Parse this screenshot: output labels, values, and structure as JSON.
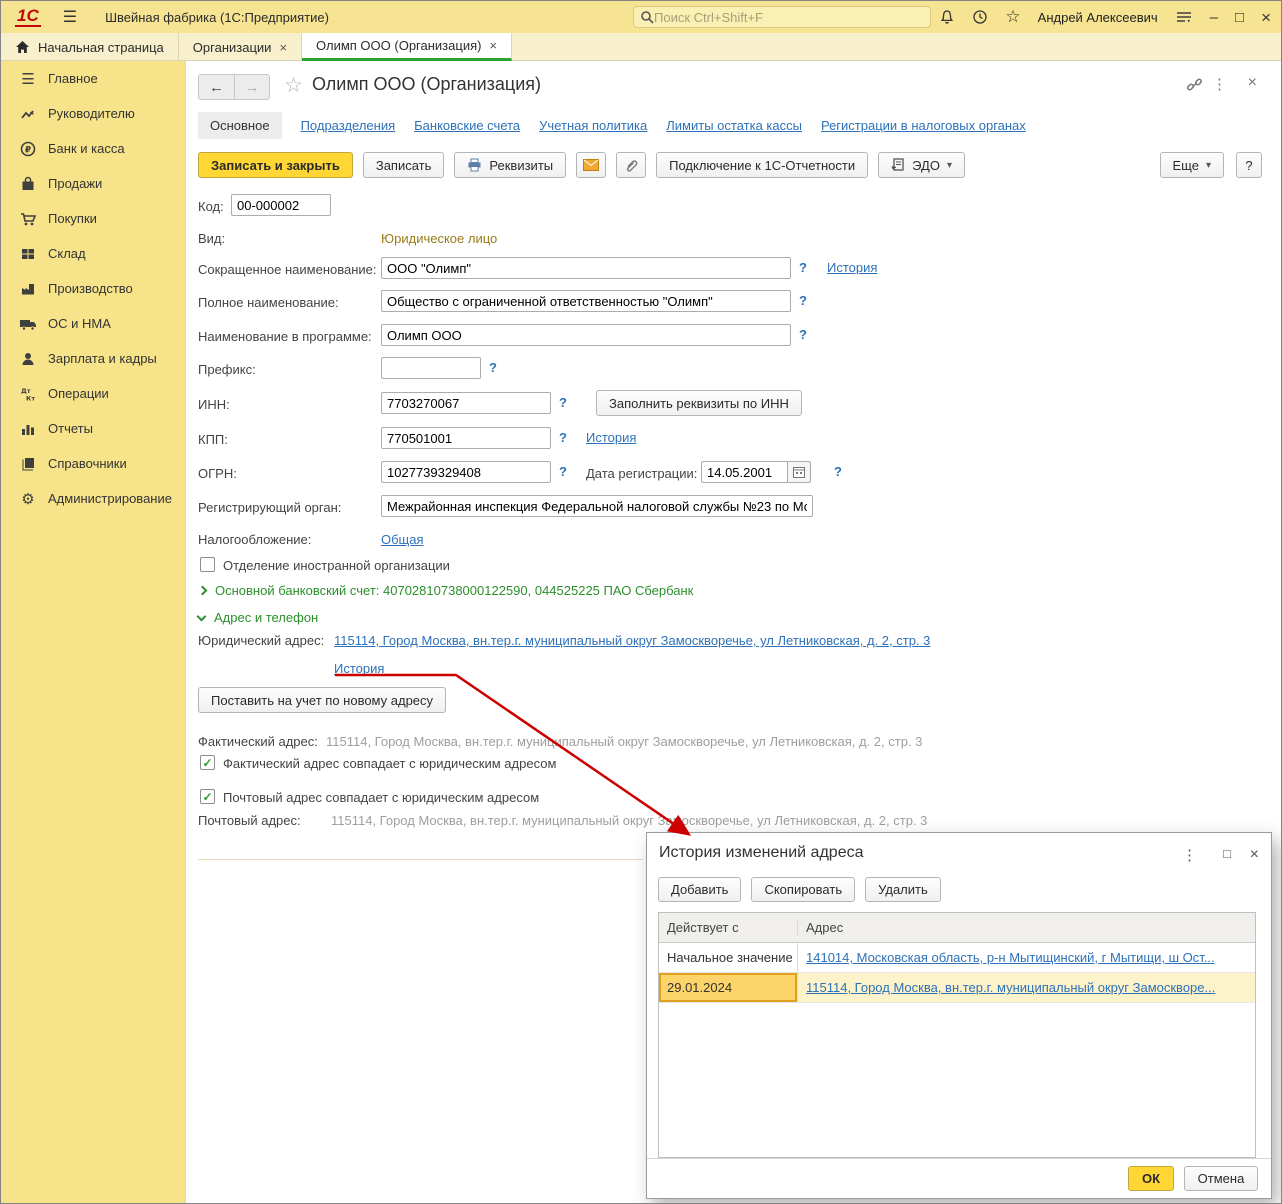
{
  "icons": {
    "hamburger": "☰",
    "star": "☆",
    "minimize": "–",
    "maximize": "□",
    "close": "×",
    "back": "←",
    "forward": "→",
    "menu_dots": "⋮",
    "dropdown": "▾",
    "check": "✓",
    "help_mark": "?",
    "gear": "⚙"
  },
  "colors": {
    "titlebar_bg": "#f6e492",
    "sidebar_bg": "#f6e38a",
    "tabbar_bg": "#f8f0cd",
    "accent_yellow": "#ffd633",
    "selection_border": "#dfa21c",
    "link_blue": "#2e71b8",
    "section_green": "#2c8f2c",
    "active_tab_green": "#2da12e",
    "annotation_red": "#cc0000"
  },
  "titlebar": {
    "logo": "1С",
    "app_title": "Швейная фабрика  (1С:Предприятие)",
    "search_placeholder": "Поиск Ctrl+Shift+F",
    "user_name": "Андрей Алексеевич"
  },
  "window_tabs": [
    {
      "label": "Начальная страница",
      "icon": "home-icon"
    },
    {
      "label": "Организации",
      "closable": true
    },
    {
      "label": "Олимп ООО (Организация)",
      "closable": true,
      "active": true
    }
  ],
  "sidebar": {
    "items": [
      {
        "label": "Главное",
        "icon": "menu-lines-icon"
      },
      {
        "label": "Руководителю",
        "icon": "trend-icon"
      },
      {
        "label": "Банк и касса",
        "icon": "ruble-icon"
      },
      {
        "label": "Продажи",
        "icon": "bag-icon"
      },
      {
        "label": "Покупки",
        "icon": "cart-icon"
      },
      {
        "label": "Склад",
        "icon": "warehouse-icon"
      },
      {
        "label": "Производство",
        "icon": "factory-icon"
      },
      {
        "label": "ОС и НМА",
        "icon": "truck-icon"
      },
      {
        "label": "Зарплата и кадры",
        "icon": "person-icon"
      },
      {
        "label": "Операции",
        "icon": "dtkt-icon"
      },
      {
        "label": "Отчеты",
        "icon": "chart-icon"
      },
      {
        "label": "Справочники",
        "icon": "books-icon"
      },
      {
        "label": "Администрирование",
        "icon": "gear-icon"
      }
    ]
  },
  "form": {
    "title": "Олимп ООО (Организация)",
    "nav_tabs": [
      {
        "label": "Основное",
        "active": true
      },
      {
        "label": "Подразделения"
      },
      {
        "label": "Банковские счета"
      },
      {
        "label": "Учетная политика"
      },
      {
        "label": "Лимиты остатка кассы"
      },
      {
        "label": "Регистрации в налоговых органах"
      }
    ],
    "toolbar": {
      "save_close": "Записать и закрыть",
      "save": "Записать",
      "requisites": "Реквизиты",
      "connect": "Подключение к 1С-Отчетности",
      "edo": "ЭДО",
      "more": "Еще",
      "help": "?"
    },
    "fields": {
      "code_label": "Код:",
      "code_value": "00-000002",
      "kind_label": "Вид:",
      "kind_value": "Юридическое лицо",
      "short_name_label": "Сокращенное наименование:",
      "short_name_value": "ООО \"Олимп\"",
      "short_name_history": "История",
      "full_name_label": "Полное наименование:",
      "full_name_value": "Общество с ограниченной ответственностью \"Олимп\"",
      "program_name_label": "Наименование в программе:",
      "program_name_value": "Олимп ООО",
      "prefix_label": "Префикс:",
      "prefix_value": "",
      "inn_label": "ИНН:",
      "inn_value": "7703270067",
      "fill_by_inn": "Заполнить реквизиты по ИНН",
      "kpp_label": "КПП:",
      "kpp_value": "770501001",
      "kpp_history": "История",
      "ogrn_label": "ОГРН:",
      "ogrn_value": "1027739329408",
      "reg_date_label": "Дата регистрации:",
      "reg_date_value": "14.05.2001",
      "reg_authority_label": "Регистрирующий орган:",
      "reg_authority_value": "Межрайонная инспекция Федеральной налоговой службы №23 по Мо",
      "taxation_label": "Налогообложение:",
      "taxation_value": "Общая",
      "foreign_branch_label": "Отделение иностранной организации",
      "bank_account_summary": "Основной банковский счет: 40702810738000122590, 044525225 ПАО Сбербанк",
      "address_section_label": "Адрес и телефон",
      "legal_address_label": "Юридический адрес:",
      "legal_address_value": "115114, Город Москва, вн.тер.г. муниципальный округ Замоскворечье, ул Летниковская, д. 2, стр. 3",
      "address_history": "История",
      "register_new_address": "Поставить на учет по новому адресу",
      "actual_address_label": "Фактический адрес:",
      "actual_address_value": "115114, Город Москва, вн.тер.г. муниципальный округ Замоскворечье, ул Летниковская, д. 2, стр. 3",
      "actual_same_label": "Фактический адрес совпадает с юридическим адресом",
      "postal_same_label": "Почтовый адрес совпадает с юридическим адресом",
      "postal_address_label": "Почтовый адрес:",
      "postal_address_value": "115114, Город Москва, вн.тер.г. муниципальный округ Замоскворечье, ул Летниковская, д. 2, стр. 3"
    }
  },
  "dialog": {
    "title": "История изменений адреса",
    "toolbar": {
      "add": "Добавить",
      "copy": "Скопировать",
      "delete": "Удалить"
    },
    "table": {
      "columns": [
        "Действует с",
        "Адрес"
      ],
      "rows": [
        {
          "date": "Начальное значение",
          "address": "141014, Московская область, р-н Мытищинский, г Мытищи, ш Ост...",
          "selected": false
        },
        {
          "date": "29.01.2024",
          "address": "115114, Город Москва, вн.тер.г. муниципальный округ Замоскворе...",
          "selected": true
        }
      ]
    },
    "ok": "ОК",
    "cancel": "Отмена"
  }
}
